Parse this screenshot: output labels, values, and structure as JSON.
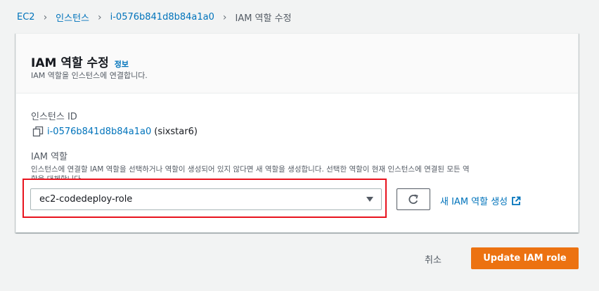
{
  "breadcrumb": {
    "items": [
      "EC2",
      "인스턴스",
      "i-0576b841d8b84a1a0"
    ],
    "current": "IAM 역할 수정"
  },
  "panel": {
    "title": "IAM 역할 수정",
    "info_link": "정보",
    "subtitle": "IAM 역할을 인스턴스에 연결합니다."
  },
  "instance": {
    "label": "인스턴스 ID",
    "id": "i-0576b841d8b84a1a0",
    "name_suffix": "(sixstar6)"
  },
  "iam_role": {
    "label": "IAM 역할",
    "description": "인스턴스에 연결할 IAM 역할을 선택하거나 역할이 생성되어 있지 않다면 새 역할을 생성합니다. 선택한 역할이 현재 인스턴스에 연결된 모든 역",
    "description_cont": "할을 대체합니다.",
    "selected_value": "ec2-codedeploy-role",
    "create_link": "새 IAM 역할 생성"
  },
  "actions": {
    "cancel": "취소",
    "update": "Update IAM role"
  },
  "colors": {
    "link": "#0073bb",
    "primary": "#ec7211",
    "highlight": "#e8131e"
  }
}
